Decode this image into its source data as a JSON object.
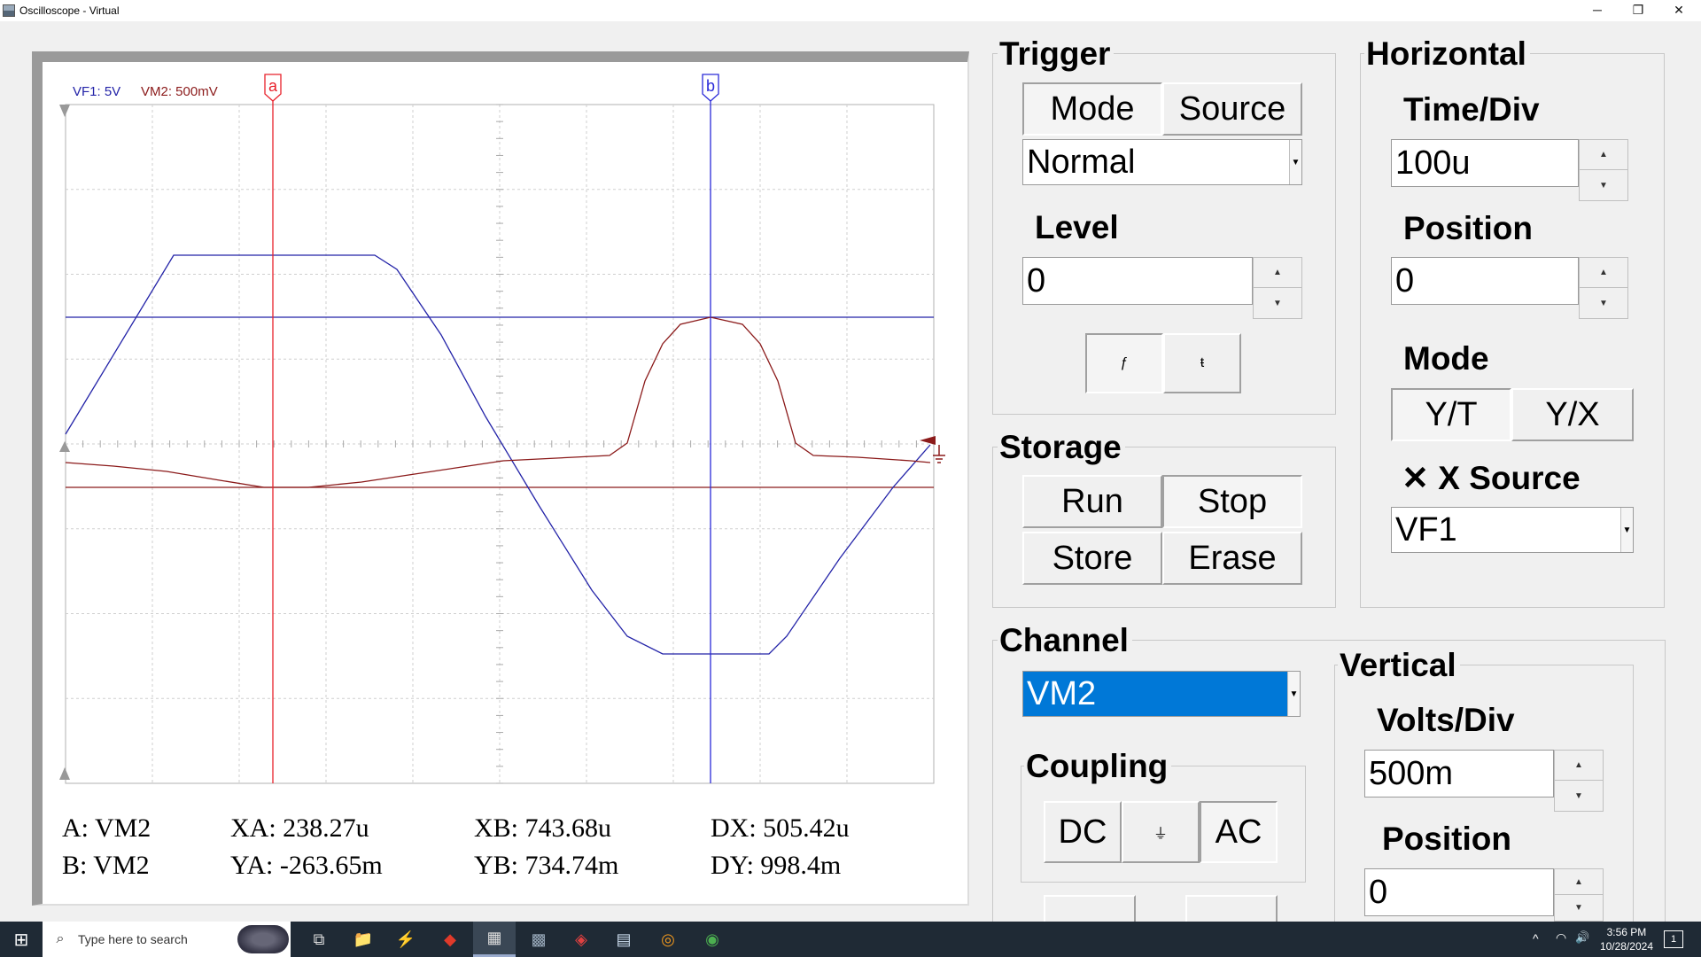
{
  "window": {
    "title": "Oscilloscope - Virtual",
    "minimize_glyph": "─",
    "restore_glyph": "❐",
    "close_glyph": "✕"
  },
  "scope": {
    "label_ch1": "VF1: 5V",
    "label_ch2": "VM2: 500mV",
    "cursor_a": "a",
    "cursor_b": "b",
    "colors": {
      "ch1": "#2323a8",
      "ch2": "#8b1a1a",
      "cursor_a": "#e8202a",
      "cursor_b": "#2a2ad8",
      "grid": "#c8c8c8"
    }
  },
  "readouts": {
    "a_label": "A: VM2",
    "b_label": "B: VM2",
    "xa": "XA: 238.27u",
    "ya": "YA: -263.65m",
    "xb": "XB: 743.68u",
    "yb": "YB: 734.74m",
    "dx": "DX: 505.42u",
    "dy": "DY: 998.4m"
  },
  "trigger": {
    "title": "Trigger",
    "mode_btn": "Mode",
    "source_btn": "Source",
    "mode_value": "Normal",
    "level_label": "Level",
    "level_value": "0",
    "rising_glyph": "ƒ",
    "falling_glyph": "ŧ"
  },
  "horizontal": {
    "title": "Horizontal",
    "timediv_label": "Time/Div",
    "timediv_value": "100u",
    "position_label": "Position",
    "position_value": "0",
    "mode_label": "Mode",
    "yt_btn": "Y/T",
    "yx_btn": "Y/X",
    "xsource_label": "X Source",
    "xsource_value": "VF1"
  },
  "storage": {
    "title": "Storage",
    "run_btn": "Run",
    "stop_btn": "Stop",
    "store_btn": "Store",
    "erase_btn": "Erase"
  },
  "channel": {
    "title": "Channel",
    "value": "VM2",
    "coupling_label": "Coupling",
    "dc_btn": "DC",
    "gnd_glyph": "⏚",
    "ac_btn": "AC"
  },
  "vertical": {
    "title": "Vertical",
    "voltsdiv_label": "Volts/Div",
    "voltsdiv_value": "500m",
    "position_label": "Position",
    "position_value": "0"
  },
  "taskbar": {
    "start_glyph": "⊞",
    "search_icon": "⌕",
    "search_placeholder": "Type here to search",
    "apps": [
      "⧉",
      "📁",
      "⚡",
      "◆",
      "▦",
      "▩",
      "◈",
      "▤",
      "◎",
      "◉"
    ],
    "time": "3:56 PM",
    "date": "10/28/2024",
    "tray_up": "^",
    "tray_wifi": "◠",
    "tray_vol": "🔊",
    "notif": "1"
  },
  "spin_up": "▲",
  "spin_down": "▼",
  "dropdown_glyph": "▼"
}
